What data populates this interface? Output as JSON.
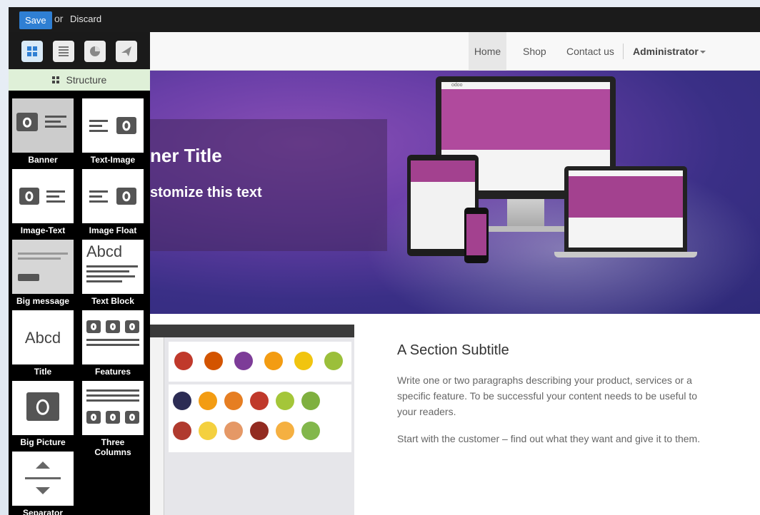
{
  "topbar": {
    "save_label": "Save",
    "or_label": "or",
    "discard_label": "Discard"
  },
  "panel": {
    "tabs": [
      {
        "icon": "structure-grid-icon"
      },
      {
        "icon": "content-lines-icon"
      },
      {
        "icon": "features-pie-icon"
      },
      {
        "icon": "effects-send-icon"
      }
    ],
    "section_label": "Structure",
    "snippets": [
      {
        "label": "Banner"
      },
      {
        "label": "Text-Image"
      },
      {
        "label": "Image-Text"
      },
      {
        "label": "Image Float"
      },
      {
        "label": "Big message"
      },
      {
        "label": "Text Block",
        "thumb_text": "Abcd"
      },
      {
        "label": "Title",
        "thumb_text": "Abcd"
      },
      {
        "label": "Features"
      },
      {
        "label": "Big Picture"
      },
      {
        "label": "Three Columns"
      },
      {
        "label": "Separator"
      }
    ]
  },
  "navbar": {
    "items": [
      "Home",
      "Shop",
      "Contact us"
    ],
    "user": "Administrator"
  },
  "banner": {
    "title": "ner Title",
    "text": "stomize this text",
    "device_logo": "odoo"
  },
  "section": {
    "subtitle": "A Section Subtitle",
    "paragraph1": "Write one or two paragraphs describing your product, services or a specific feature. To be successful your content needs to be useful to your readers.",
    "paragraph2": "Start with the customer – find out what they want and give it to them."
  },
  "colors": {
    "accent": "#2f7fd3",
    "structure_bg": "#dff0d8",
    "banner": "#5b3a9c"
  }
}
